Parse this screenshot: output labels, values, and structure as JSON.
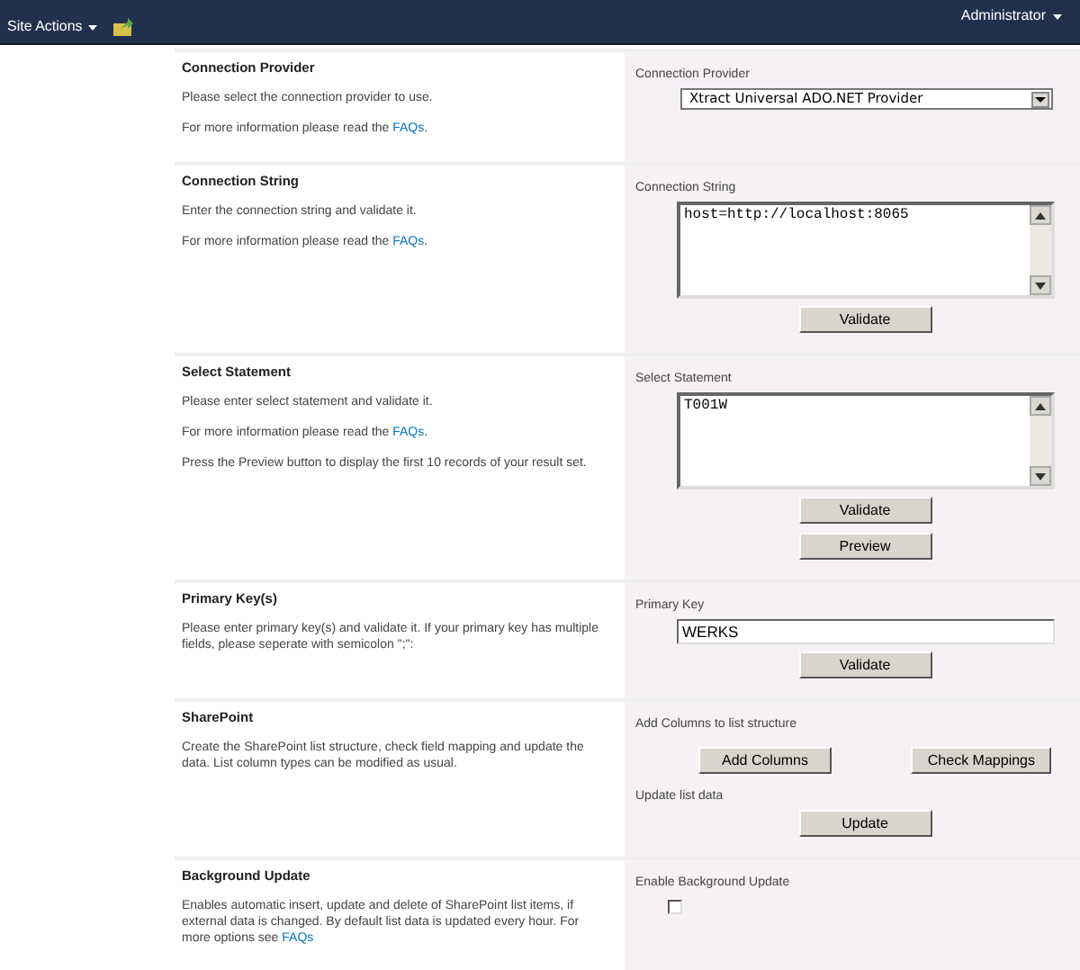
{
  "top_bar": {
    "site_actions": "Site Actions",
    "user": "Administrator"
  },
  "sections": [
    {
      "title": "Connection Provider",
      "paragraphs": [
        [
          {
            "text": "Please select the connection provider to use."
          }
        ],
        [
          {
            "text": "For more information please read the "
          },
          {
            "link": "FAQs"
          },
          {
            "text": "."
          }
        ]
      ],
      "controls": [
        {
          "kind": "label",
          "text": "Connection Provider"
        },
        {
          "kind": "select",
          "value": "Xtract Universal ADO.NET Provider"
        }
      ]
    },
    {
      "title": "Connection String",
      "paragraphs": [
        [
          {
            "text": "Enter the connection string and validate it."
          }
        ],
        [
          {
            "text": "For more information please read the "
          },
          {
            "link": "FAQs"
          },
          {
            "text": "."
          }
        ]
      ],
      "controls": [
        {
          "kind": "label",
          "text": "Connection String"
        },
        {
          "kind": "textarea",
          "value": "host=http://localhost:8065"
        },
        {
          "kind": "buttons",
          "labels": [
            "Validate"
          ]
        }
      ]
    },
    {
      "title": "Select Statement",
      "paragraphs": [
        [
          {
            "text": "Please enter select statement and validate it."
          }
        ],
        [
          {
            "text": "For more information please read the "
          },
          {
            "link": "FAQs"
          },
          {
            "text": "."
          }
        ],
        [
          {
            "text": "Press the Preview button to display the first 10 records of your result set."
          }
        ]
      ],
      "controls": [
        {
          "kind": "label",
          "text": "Select Statement"
        },
        {
          "kind": "textarea",
          "value": "T001W"
        },
        {
          "kind": "buttons",
          "labels": [
            "Validate"
          ]
        },
        {
          "kind": "buttons",
          "labels": [
            "Preview"
          ]
        }
      ]
    },
    {
      "title": "Primary Key(s)",
      "paragraphs": [
        [
          {
            "text": "Please enter primary key(s) and validate it. If your primary key has multiple fields, please seperate with semicolon \";\":"
          }
        ]
      ],
      "controls": [
        {
          "kind": "label",
          "text": "Primary Key"
        },
        {
          "kind": "input",
          "value": "WERKS"
        },
        {
          "kind": "buttons",
          "labels": [
            "Validate"
          ]
        }
      ]
    },
    {
      "title": "SharePoint",
      "paragraphs": [
        [
          {
            "text": "Create the SharePoint list structure, check field mapping and update the data. List column types can be modified as usual."
          }
        ]
      ],
      "controls": [
        {
          "kind": "label",
          "text": "Add Columns to list structure"
        },
        {
          "kind": "buttons",
          "labels": [
            "Add Columns",
            "Check Mappings"
          ]
        },
        {
          "kind": "label",
          "text": "Update list data"
        },
        {
          "kind": "buttons",
          "labels": [
            "Update"
          ]
        }
      ]
    },
    {
      "title": "Background Update",
      "paragraphs": [
        [
          {
            "text": "Enables automatic insert, update and delete of SharePoint list items, if external data is changed. By default list data is updated every hour. For more options see "
          },
          {
            "link": "FAQs"
          }
        ]
      ],
      "controls": [
        {
          "kind": "label",
          "text": "Enable Background Update"
        },
        {
          "kind": "checkbox",
          "checked": false
        }
      ]
    }
  ]
}
